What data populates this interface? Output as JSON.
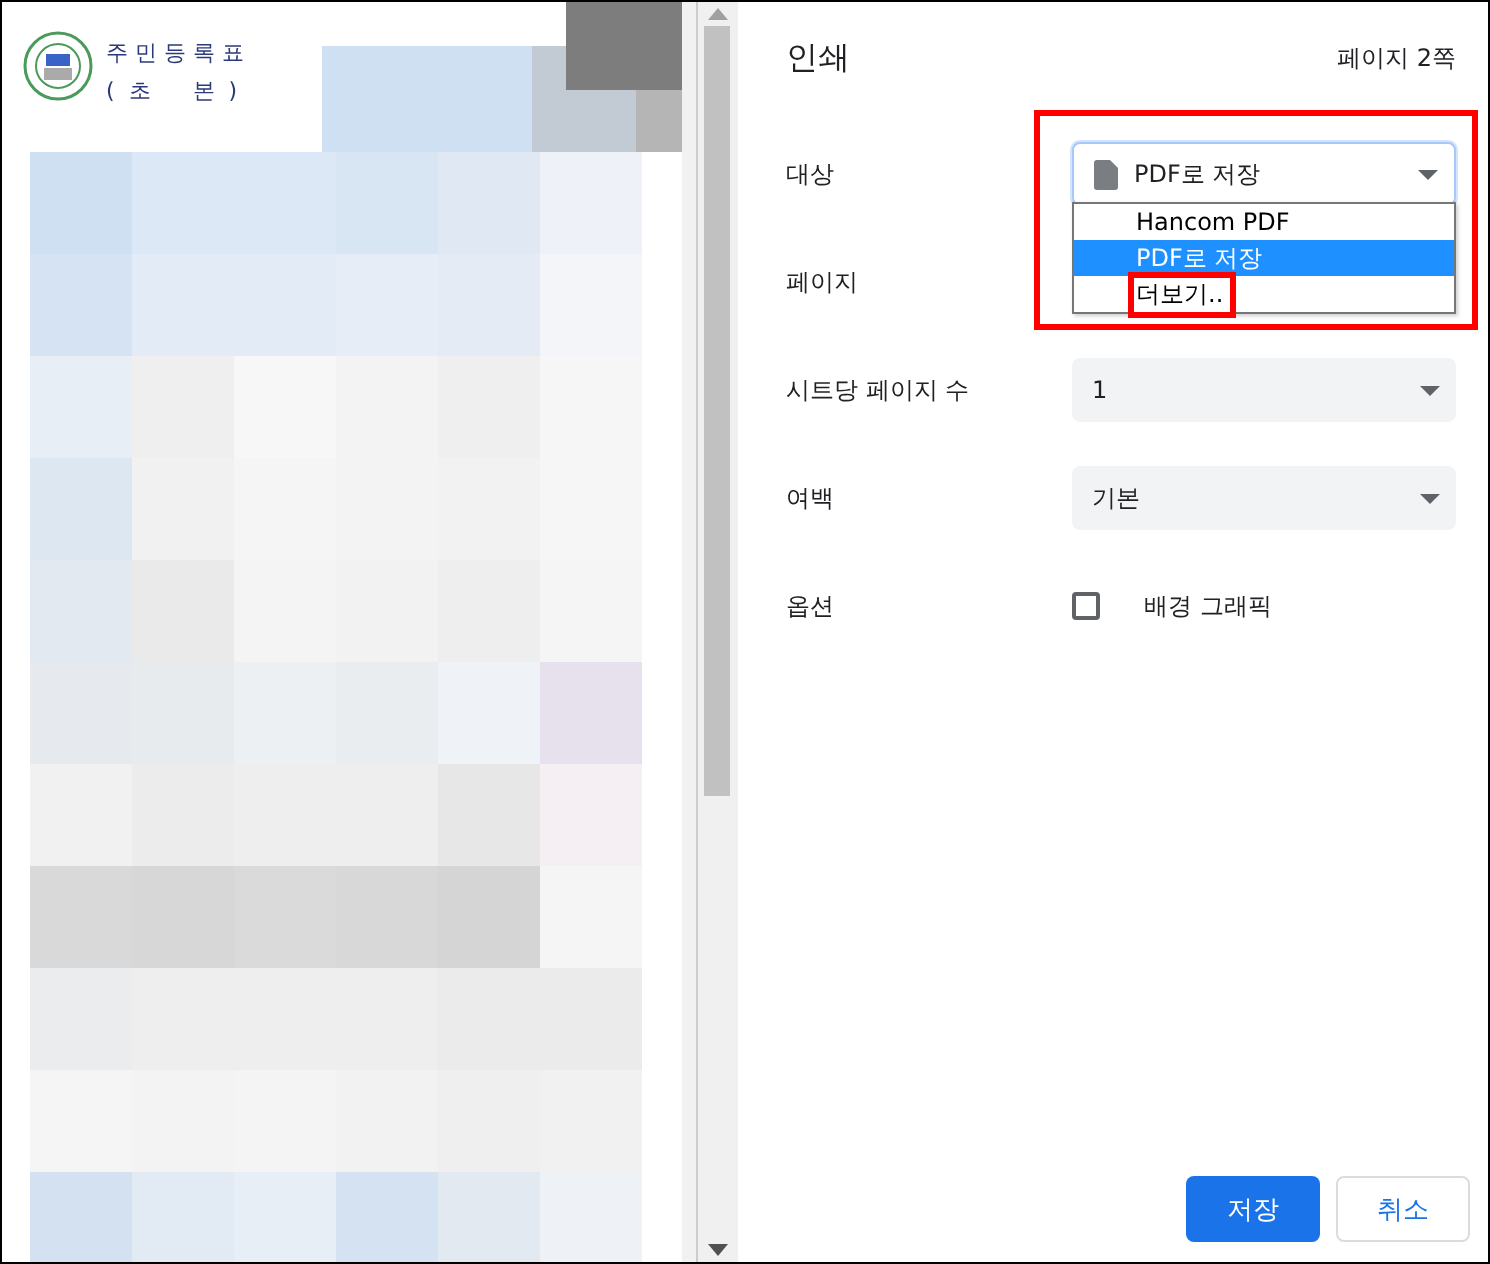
{
  "preview": {
    "title_line_1": "주 민 등 록 표",
    "title_line_2": "(  초      본  )"
  },
  "dialog": {
    "title": "인쇄",
    "page_count": "페이지 2쪽"
  },
  "settings": [
    {
      "label": "대상",
      "kind": "destination",
      "value": "PDF로 저장",
      "expanded": true,
      "options": [
        {
          "label": "Hancom PDF",
          "selected": false
        },
        {
          "label": "PDF로 저장",
          "selected": true
        },
        {
          "label": "더보기..",
          "selected": false
        }
      ]
    },
    {
      "label": "페이지",
      "kind": "hidden"
    },
    {
      "label": "시트당 페이지 수",
      "kind": "select",
      "value": "1"
    },
    {
      "label": "여백",
      "kind": "select",
      "value": "기본"
    },
    {
      "label": "옵션",
      "kind": "checkbox",
      "text": "배경 그래픽",
      "checked": false
    }
  ],
  "buttons": [
    {
      "label": "저장",
      "kind": "primary"
    },
    {
      "label": "취소",
      "kind": "secondary"
    }
  ]
}
